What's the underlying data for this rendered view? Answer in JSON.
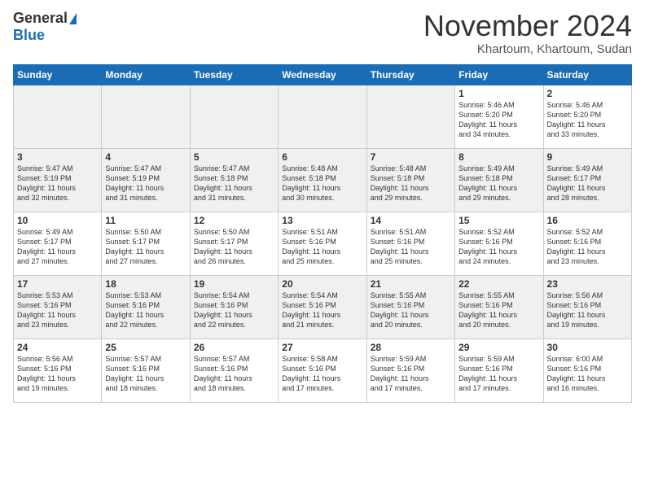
{
  "header": {
    "logo_line1": "General",
    "logo_line2": "Blue",
    "month": "November 2024",
    "location": "Khartoum, Khartoum, Sudan"
  },
  "weekdays": [
    "Sunday",
    "Monday",
    "Tuesday",
    "Wednesday",
    "Thursday",
    "Friday",
    "Saturday"
  ],
  "weeks": [
    [
      {
        "day": "",
        "info": ""
      },
      {
        "day": "",
        "info": ""
      },
      {
        "day": "",
        "info": ""
      },
      {
        "day": "",
        "info": ""
      },
      {
        "day": "",
        "info": ""
      },
      {
        "day": "1",
        "info": "Sunrise: 5:46 AM\nSunset: 5:20 PM\nDaylight: 11 hours\nand 34 minutes."
      },
      {
        "day": "2",
        "info": "Sunrise: 5:46 AM\nSunset: 5:20 PM\nDaylight: 11 hours\nand 33 minutes."
      }
    ],
    [
      {
        "day": "3",
        "info": "Sunrise: 5:47 AM\nSunset: 5:19 PM\nDaylight: 11 hours\nand 32 minutes."
      },
      {
        "day": "4",
        "info": "Sunrise: 5:47 AM\nSunset: 5:19 PM\nDaylight: 11 hours\nand 31 minutes."
      },
      {
        "day": "5",
        "info": "Sunrise: 5:47 AM\nSunset: 5:18 PM\nDaylight: 11 hours\nand 31 minutes."
      },
      {
        "day": "6",
        "info": "Sunrise: 5:48 AM\nSunset: 5:18 PM\nDaylight: 11 hours\nand 30 minutes."
      },
      {
        "day": "7",
        "info": "Sunrise: 5:48 AM\nSunset: 5:18 PM\nDaylight: 11 hours\nand 29 minutes."
      },
      {
        "day": "8",
        "info": "Sunrise: 5:49 AM\nSunset: 5:18 PM\nDaylight: 11 hours\nand 29 minutes."
      },
      {
        "day": "9",
        "info": "Sunrise: 5:49 AM\nSunset: 5:17 PM\nDaylight: 11 hours\nand 28 minutes."
      }
    ],
    [
      {
        "day": "10",
        "info": "Sunrise: 5:49 AM\nSunset: 5:17 PM\nDaylight: 11 hours\nand 27 minutes."
      },
      {
        "day": "11",
        "info": "Sunrise: 5:50 AM\nSunset: 5:17 PM\nDaylight: 11 hours\nand 27 minutes."
      },
      {
        "day": "12",
        "info": "Sunrise: 5:50 AM\nSunset: 5:17 PM\nDaylight: 11 hours\nand 26 minutes."
      },
      {
        "day": "13",
        "info": "Sunrise: 5:51 AM\nSunset: 5:16 PM\nDaylight: 11 hours\nand 25 minutes."
      },
      {
        "day": "14",
        "info": "Sunrise: 5:51 AM\nSunset: 5:16 PM\nDaylight: 11 hours\nand 25 minutes."
      },
      {
        "day": "15",
        "info": "Sunrise: 5:52 AM\nSunset: 5:16 PM\nDaylight: 11 hours\nand 24 minutes."
      },
      {
        "day": "16",
        "info": "Sunrise: 5:52 AM\nSunset: 5:16 PM\nDaylight: 11 hours\nand 23 minutes."
      }
    ],
    [
      {
        "day": "17",
        "info": "Sunrise: 5:53 AM\nSunset: 5:16 PM\nDaylight: 11 hours\nand 23 minutes."
      },
      {
        "day": "18",
        "info": "Sunrise: 5:53 AM\nSunset: 5:16 PM\nDaylight: 11 hours\nand 22 minutes."
      },
      {
        "day": "19",
        "info": "Sunrise: 5:54 AM\nSunset: 5:16 PM\nDaylight: 11 hours\nand 22 minutes."
      },
      {
        "day": "20",
        "info": "Sunrise: 5:54 AM\nSunset: 5:16 PM\nDaylight: 11 hours\nand 21 minutes."
      },
      {
        "day": "21",
        "info": "Sunrise: 5:55 AM\nSunset: 5:16 PM\nDaylight: 11 hours\nand 20 minutes."
      },
      {
        "day": "22",
        "info": "Sunrise: 5:55 AM\nSunset: 5:16 PM\nDaylight: 11 hours\nand 20 minutes."
      },
      {
        "day": "23",
        "info": "Sunrise: 5:56 AM\nSunset: 5:16 PM\nDaylight: 11 hours\nand 19 minutes."
      }
    ],
    [
      {
        "day": "24",
        "info": "Sunrise: 5:56 AM\nSunset: 5:16 PM\nDaylight: 11 hours\nand 19 minutes."
      },
      {
        "day": "25",
        "info": "Sunrise: 5:57 AM\nSunset: 5:16 PM\nDaylight: 11 hours\nand 18 minutes."
      },
      {
        "day": "26",
        "info": "Sunrise: 5:57 AM\nSunset: 5:16 PM\nDaylight: 11 hours\nand 18 minutes."
      },
      {
        "day": "27",
        "info": "Sunrise: 5:58 AM\nSunset: 5:16 PM\nDaylight: 11 hours\nand 17 minutes."
      },
      {
        "day": "28",
        "info": "Sunrise: 5:59 AM\nSunset: 5:16 PM\nDaylight: 11 hours\nand 17 minutes."
      },
      {
        "day": "29",
        "info": "Sunrise: 5:59 AM\nSunset: 5:16 PM\nDaylight: 11 hours\nand 17 minutes."
      },
      {
        "day": "30",
        "info": "Sunrise: 6:00 AM\nSunset: 5:16 PM\nDaylight: 11 hours\nand 16 minutes."
      }
    ]
  ]
}
